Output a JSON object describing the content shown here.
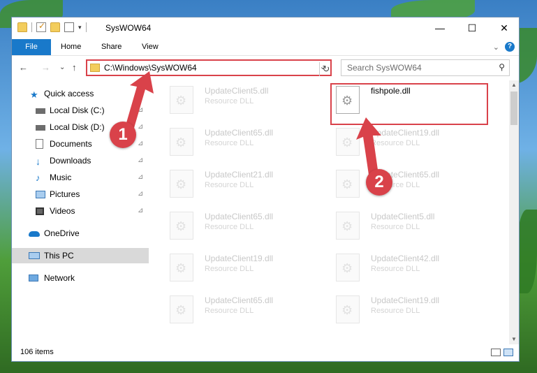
{
  "window": {
    "title": "SysWOW64",
    "minimize_glyph": "—",
    "maximize_glyph": "☐",
    "close_glyph": "✕"
  },
  "ribbon": {
    "tabs": [
      "File",
      "Home",
      "Share",
      "View"
    ],
    "expand_glyph": "⌄",
    "help_glyph": "?"
  },
  "address": {
    "path": "C:\\Windows\\SysWOW64",
    "dropdown_glyph": "⌄",
    "refresh_glyph": "↻"
  },
  "search": {
    "placeholder": "Search SysWOW64",
    "icon_glyph": "⚲"
  },
  "nav_glyphs": {
    "back": "←",
    "forward": "→",
    "recent": "⌄",
    "up": "↑"
  },
  "navpane": {
    "items": [
      {
        "label": "Quick access",
        "icon": "star-icon",
        "pinned": false
      },
      {
        "label": "Local Disk (C:)",
        "icon": "drive-icon",
        "pinned": true
      },
      {
        "label": "Local Disk (D:)",
        "icon": "drive-icon",
        "pinned": true
      },
      {
        "label": "Documents",
        "icon": "documents-icon",
        "pinned": true
      },
      {
        "label": "Downloads",
        "icon": "downloads-icon",
        "pinned": true
      },
      {
        "label": "Music",
        "icon": "music-icon",
        "pinned": true
      },
      {
        "label": "Pictures",
        "icon": "pictures-icon",
        "pinned": true
      },
      {
        "label": "Videos",
        "icon": "videos-icon",
        "pinned": true
      },
      {
        "label": "OneDrive",
        "icon": "onedrive-icon",
        "pinned": false
      },
      {
        "label": "This PC",
        "icon": "pc-icon",
        "pinned": false
      },
      {
        "label": "Network",
        "icon": "network-icon",
        "pinned": false
      }
    ],
    "pin_glyph": "📌",
    "selected": "This PC"
  },
  "files": [
    {
      "name": "UpdateClient5.dll",
      "type": "Resource DLL"
    },
    {
      "name": "fishpole.dll",
      "type": ""
    },
    {
      "name": "UpdateClient65.dll",
      "type": "Resource DLL"
    },
    {
      "name": "UpdateClient19.dll",
      "type": "Resource DLL"
    },
    {
      "name": "UpdateClient21.dll",
      "type": "Resource DLL"
    },
    {
      "name": "UpdateClient65.dll",
      "type": "Resource DLL"
    },
    {
      "name": "UpdateClient65.dll",
      "type": "Resource DLL"
    },
    {
      "name": "UpdateClient5.dll",
      "type": "Resource DLL"
    },
    {
      "name": "UpdateClient19.dll",
      "type": "Resource DLL"
    },
    {
      "name": "UpdateClient42.dll",
      "type": "Resource DLL"
    },
    {
      "name": "UpdateClient65.dll",
      "type": "Resource DLL"
    },
    {
      "name": "UpdateClient19.dll",
      "type": "Resource DLL"
    }
  ],
  "highlighted_file": "fishpole.dll",
  "status": {
    "item_count": "106 items"
  },
  "callouts": [
    "1",
    "2"
  ],
  "colors": {
    "accent": "#1979ca",
    "highlight": "#d9424a"
  }
}
